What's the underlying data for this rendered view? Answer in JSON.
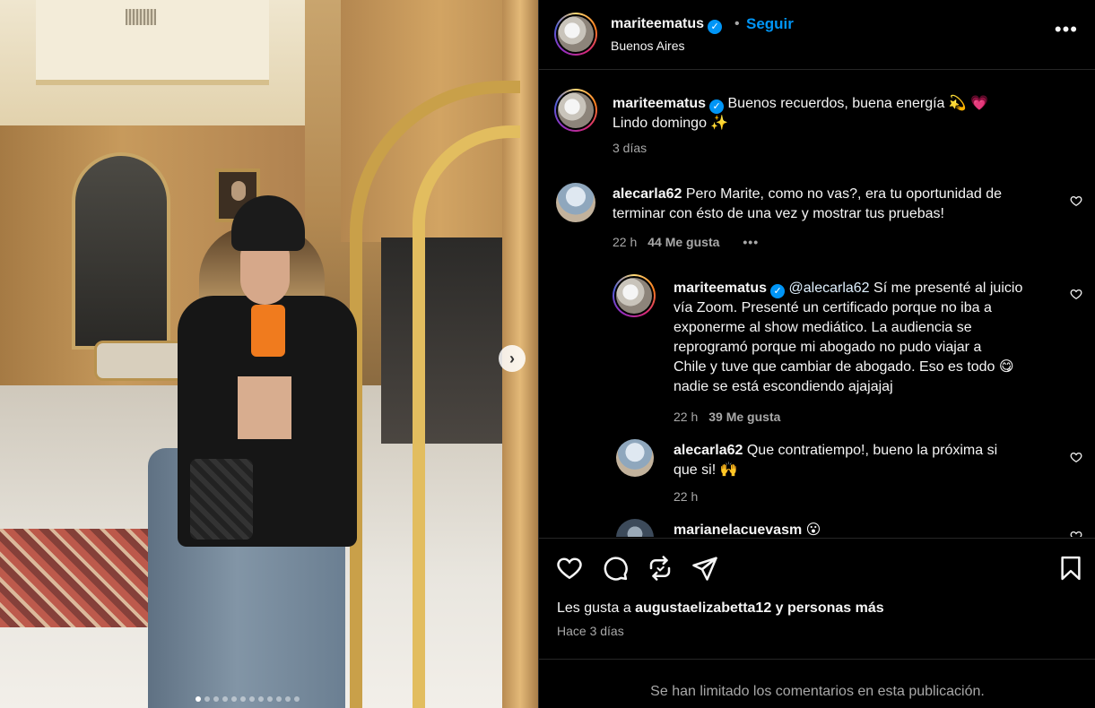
{
  "post": {
    "author": "mariteematus",
    "follow_label": "Seguir",
    "bullet": "•",
    "location": "Buenos Aires",
    "more_label": "•••",
    "caption_line1": "Buenos recuerdos, buena energía 💫 💗",
    "caption_line2": "Lindo domingo ✨",
    "caption_time": "3 días",
    "carousel_next": "›"
  },
  "comments": [
    {
      "user": "alecarla62",
      "text_line1": "Pero Marite, como no vas?, era tu oportunidad de",
      "text_line2": "terminar con ésto de una vez y mostrar tus pruebas!",
      "time": "22 h",
      "likes": "44 Me gusta",
      "more": "•••"
    },
    {
      "user": "mariteematus",
      "mention": "@alecarla62",
      "lines": [
        "Sí me presenté al juicio",
        "vía Zoom. Presenté un certificado porque no iba a",
        "exponerme al show mediático. La audiencia se",
        "reprogramó porque mi abogado no pudo viajar a",
        "Chile y tuve que cambiar de abogado. Eso es todo 😋",
        "nadie se está escondiendo ajajajaj"
      ],
      "time": "22 h",
      "likes": "39 Me gusta"
    },
    {
      "user": "alecarla62",
      "text_line1": "Que contratiempo!, bueno la próxima si",
      "text_line2": "que si! 🙌",
      "time": "22 h"
    },
    {
      "user": "marianelacuevasm",
      "text_line1": "😮"
    }
  ],
  "likes": {
    "prefix": "Les gusta a ",
    "user": "augustaelizabetta12",
    "suffix": " y personas más"
  },
  "date": "Hace 3 días",
  "comments_limited": "Se han limitado los comentarios en esta publicación.",
  "icons": [
    "heart-icon",
    "comment-icon",
    "repost-icon",
    "share-icon",
    "bookmark-icon",
    "verified-icon",
    "ellipsis-icon"
  ],
  "colors": {
    "accent": "#0095f6",
    "background": "#000000",
    "muted": "#a8a8a8"
  },
  "carousel": {
    "total": 12,
    "active": 1
  }
}
